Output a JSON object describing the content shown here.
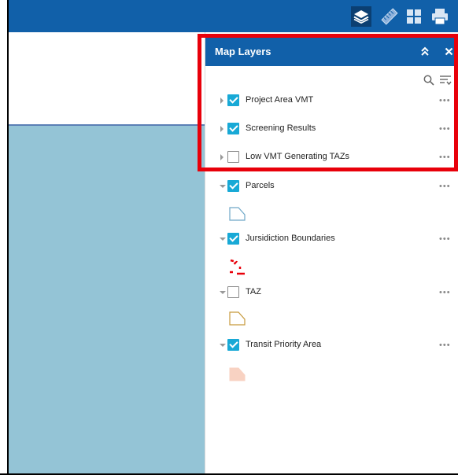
{
  "toolbar": {
    "tools": [
      {
        "name": "layers-icon",
        "active": true
      },
      {
        "name": "measure-icon",
        "active": false
      },
      {
        "name": "basemap-gallery-icon",
        "active": false
      },
      {
        "name": "print-icon",
        "active": false
      }
    ]
  },
  "panel": {
    "title": "Map Layers",
    "collapse_icon": "double-chevron-up-icon",
    "close_icon": "close-icon",
    "tools": [
      "search-icon",
      "filter-icon"
    ]
  },
  "layers": [
    {
      "label": "Project Area VMT",
      "checked": true,
      "expanded": false,
      "more": "•••"
    },
    {
      "label": "Screening Results",
      "checked": true,
      "expanded": false,
      "more": "•••"
    },
    {
      "label": "Low VMT Generating TAZs",
      "checked": false,
      "expanded": false,
      "more": "•••"
    },
    {
      "label": "Parcels",
      "checked": true,
      "expanded": true,
      "more": "•••",
      "legend": "outline-polygon-blue",
      "legend_color": "#6fa8c8"
    },
    {
      "label": "Jursidiction Boundaries",
      "checked": true,
      "expanded": true,
      "more": "•••",
      "legend": "dashed-boundary-red",
      "legend_color": "#e8000a"
    },
    {
      "label": "TAZ",
      "checked": false,
      "expanded": true,
      "more": "•••",
      "legend": "outline-polygon-tan",
      "legend_color": "#c79a3c"
    },
    {
      "label": "Transit Priority Area",
      "checked": true,
      "expanded": true,
      "more": "•••",
      "legend": "filled-polygon-peach",
      "legend_color": "#f8d2c2"
    }
  ],
  "colors": {
    "header": "#1160a9",
    "checkbox_on": "#18a9d6",
    "highlight": "#e8000a",
    "map_water": "#94c4d6"
  }
}
